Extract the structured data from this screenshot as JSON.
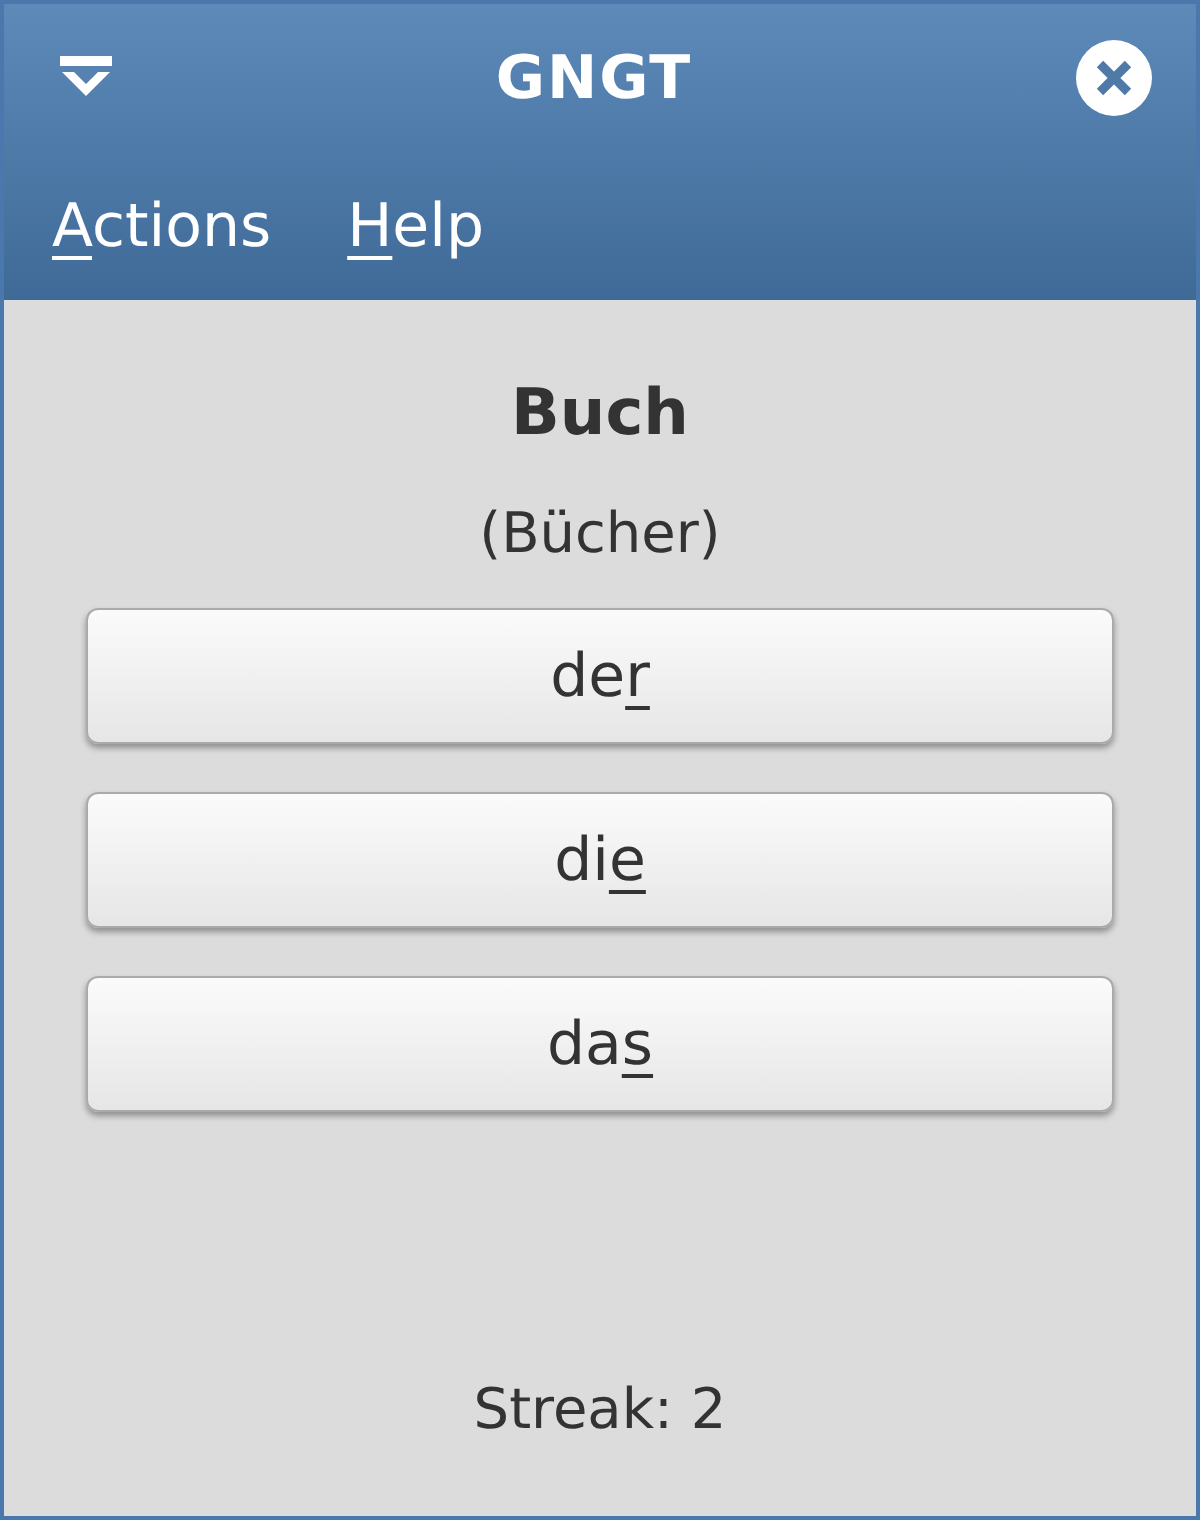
{
  "window": {
    "title": "GNGT"
  },
  "menu": [
    {
      "key": "A",
      "after": "ctions"
    },
    {
      "key": "H",
      "after": "elp"
    }
  ],
  "word": "Buch",
  "plural": "(Bücher)",
  "articles": [
    {
      "before": "de",
      "key": "r"
    },
    {
      "before": "di",
      "key": "e"
    },
    {
      "before": "da",
      "key": "s"
    }
  ],
  "status": "Streak: 2"
}
